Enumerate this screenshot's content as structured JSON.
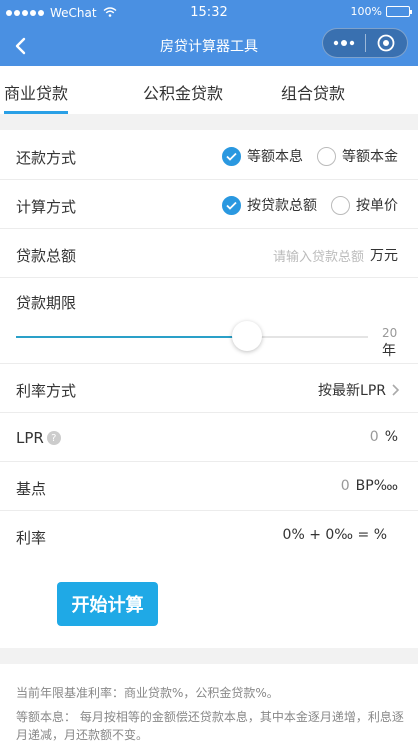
{
  "status": {
    "carrier": "WeChat",
    "time": "15:32",
    "battery": "100%"
  },
  "nav": {
    "title": "房贷计算器工具"
  },
  "tabs": [
    {
      "label": "商业贷款",
      "active": true
    },
    {
      "label": "公积金贷款",
      "active": false
    },
    {
      "label": "组合贷款",
      "active": false
    }
  ],
  "form": {
    "repayment": {
      "label": "还款方式",
      "options": [
        {
          "label": "等额本息",
          "checked": true
        },
        {
          "label": "等额本金",
          "checked": false
        }
      ]
    },
    "calc": {
      "label": "计算方式",
      "options": [
        {
          "label": "按贷款总额",
          "checked": true
        },
        {
          "label": "按单价",
          "checked": false
        }
      ]
    },
    "total": {
      "label": "贷款总额",
      "placeholder": "请输入贷款总额",
      "unit": "万元"
    },
    "term": {
      "label": "贷款期限",
      "value": "20",
      "unit": "年",
      "min": 1,
      "max": 30,
      "current": 20
    },
    "rate_mode": {
      "label": "利率方式",
      "value": "按最新LPR"
    },
    "lpr": {
      "label": "LPR",
      "value": "0",
      "unit": "%"
    },
    "basis": {
      "label": "基点",
      "value": "0",
      "unit": "BP‱"
    },
    "rate": {
      "label": "利率",
      "value": "0% + 0‰ = %"
    },
    "submit_label": "开始计算"
  },
  "notes": {
    "line1": "当前年限基准利率：商业贷款%，公积金贷款%。",
    "line2": "等额本息： 每月按相等的金额偿还贷款本息，其中本金逐月递增，利息逐月递减，月还款额不变。"
  },
  "colors": {
    "primary": "#4a90e2",
    "accent": "#2a98e0",
    "button": "#1fa9e6"
  }
}
